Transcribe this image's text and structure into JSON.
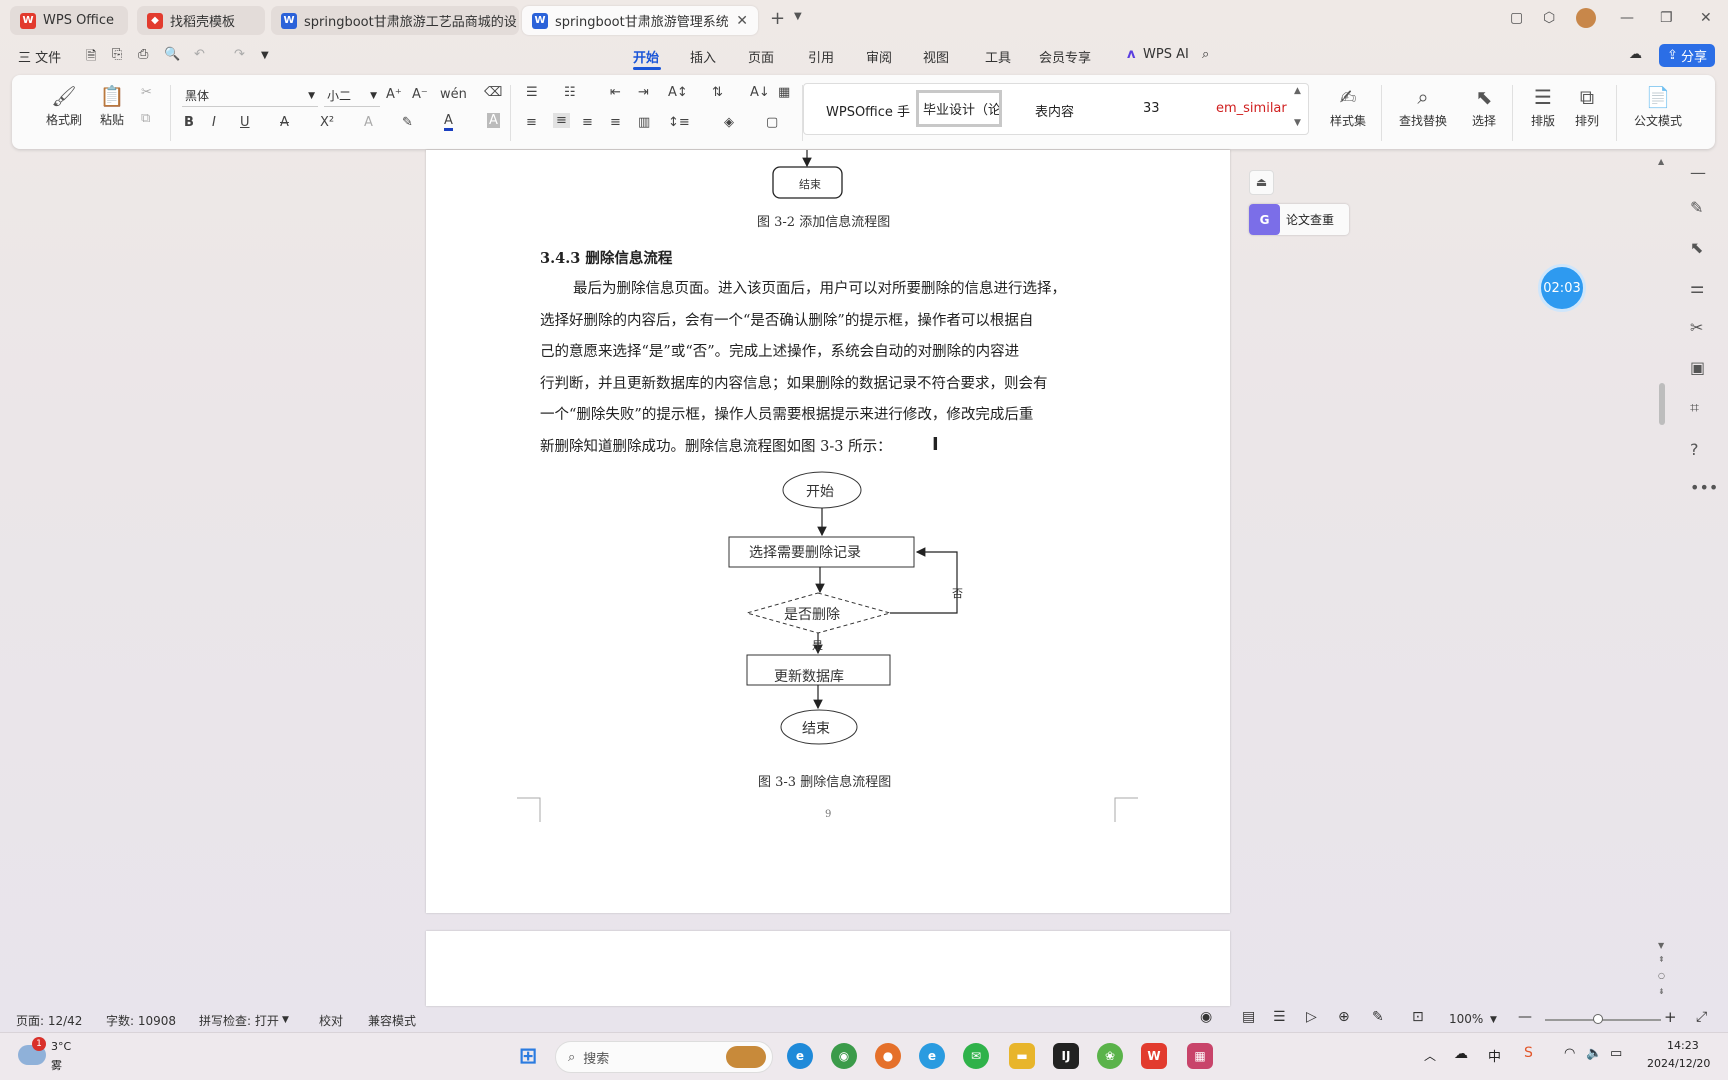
{
  "tabs": [
    {
      "label": "WPS Office"
    },
    {
      "label": "找稻壳模板"
    },
    {
      "label": "springboot甘肃旅游工艺品商城的设"
    },
    {
      "label": "springboot甘肃旅游管理系统.doc"
    }
  ],
  "menu": {
    "file": "三 文件",
    "items": [
      "开始",
      "插入",
      "页面",
      "引用",
      "审阅",
      "视图",
      "工具",
      "会员专享"
    ],
    "wps_ai": "WPS AI",
    "share": "分享"
  },
  "ribbon": {
    "format_painter": "格式刷",
    "paste": "粘贴",
    "font_name": "黑体",
    "font_size": "小二",
    "styles": [
      "WPSOffice 手",
      "毕业设计（论",
      "表内容",
      "33",
      "em_similar"
    ],
    "style_set": "样式集",
    "find_replace": "查找替换",
    "select": "选择",
    "layout": "排版",
    "arrange": "排列",
    "official_mode": "公文模式"
  },
  "document": {
    "prev_end_node": "结束",
    "fig_3_2_caption": "图 3-2 添加信息流程图",
    "section_heading": "3.4.3 删除信息流程",
    "paragraph_lines": [
      "最后为删除信息页面。进入该页面后，用户可以对所要删除的信息进行选择，",
      "选择好删除的内容后，会有一个“是否确认删除”的提示框，操作者可以根据自",
      "己的意愿来选择“是”或“否”。完成上述操作，系统会自动的对删除的内容进",
      "行判断，并且更新数据库的内容信息；如果删除的数据记录不符合要求，则会有",
      "一个“删除失败”的提示框，操作人员需要根据提示来进行修改，修改完成后重",
      "新删除知道删除成功。删除信息流程图如图 3-3 所示："
    ],
    "flow": {
      "start": "开始",
      "select": "选择需要删除记录",
      "decision": "是否删除",
      "no": "否",
      "yes": "是",
      "update": "更新数据库",
      "end": "结束"
    },
    "fig_3_3_caption": "图 3-3 删除信息流程图",
    "page_number": "9"
  },
  "side_panel": {
    "paper_check": "论文查重",
    "timer": "02:03"
  },
  "status": {
    "page": "页面: 12/42",
    "words": "字数: 10908",
    "spellcheck": "拼写检查: 打开",
    "proofread": "校对",
    "compat": "兼容模式",
    "zoom": "100%"
  },
  "taskbar": {
    "weather_temp": "3°C",
    "weather_desc": "雾",
    "weather_badge": "1",
    "search_placeholder": "搜索",
    "time": "14:23",
    "date": "2024/12/20",
    "ime": "中"
  },
  "colors": {
    "accent": "#1a55d8",
    "share_bg": "#2b6ee6",
    "timer_bg": "#2e9af0",
    "wps_red": "#e23b2e",
    "word_blue": "#2b62d9"
  }
}
